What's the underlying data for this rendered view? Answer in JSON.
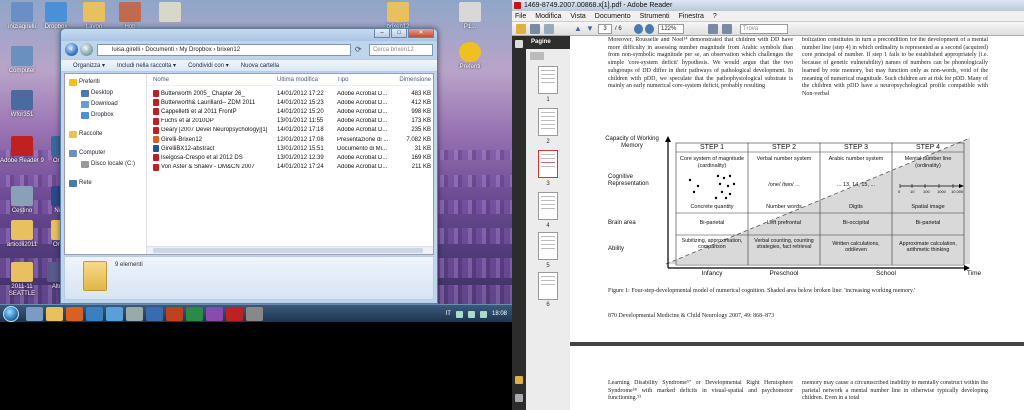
{
  "desktop": {
    "icons": [
      {
        "label": "iniziagirelli",
        "color": "#6b8fc4"
      },
      {
        "label": "Dropbox",
        "color": "#4a8fd8"
      },
      {
        "label": "Lavori",
        "color": "#e8c060"
      },
      {
        "label": "Hob",
        "color": "#c06a50"
      },
      {
        "label": "",
        "color": "#d8d8c8"
      },
      {
        "label": "brixen12",
        "color": "#e8c060"
      },
      {
        "label": "P1...",
        "color": "#d8d8d8"
      },
      {
        "label": "Computer",
        "color": "#6a90c0"
      },
      {
        "label": "Preferiti",
        "color": "#f0c020"
      },
      {
        "label": "Wfor351",
        "color": "#4a6aa0"
      },
      {
        "label": "Adobe Reader 9",
        "color": "#c02020"
      },
      {
        "label": "Ordine",
        "color": "#3a6a9a"
      },
      {
        "label": "Nokia",
        "color": "#2a4a8a"
      },
      {
        "label": "Cestino",
        "color": "#8aa0b8"
      },
      {
        "label": "articoli2011",
        "color": "#e8c060"
      },
      {
        "label": "Ordine",
        "color": "#e8c060"
      },
      {
        "label": "2011-11 SEATTLE",
        "color": "#e8c060"
      },
      {
        "label": "Altro",
        "color": "#5a5a8a"
      }
    ]
  },
  "taskbar": {
    "language": "IT",
    "clock": "18:08"
  },
  "explorer": {
    "address": "luisa.girelli  ›  Documenti  ›  My Dropbox  ›  brixen12",
    "search_placeholder": "Cerca brixen12",
    "toolbar": [
      "Organizza ▾",
      "Includi nella raccolta ▾",
      "Condividi con ▾",
      "Nuova cartella"
    ],
    "nav": {
      "favorites": "Preferiti",
      "desktop": "Desktop",
      "downloads": "Download",
      "dropbox": "Dropbox",
      "libraries": "Raccolte",
      "computer": "Computer",
      "local_disk": "Disco locale (C:)",
      "network": "Rete"
    },
    "columns": {
      "name": "Nome",
      "modified": "Ultima modifica",
      "type": "Tipo",
      "size": "Dimensione"
    },
    "files": [
      {
        "name": "Butterworth 2005_ Chapter 26_",
        "modified": "14/01/2012 17:22",
        "type": "Adobe Acrobat D...",
        "size": "483 KB",
        "color": "#c02020"
      },
      {
        "name": "Butterworth& Laurillard-- ZDM 2011",
        "modified": "14/01/2012 15:23",
        "type": "Adobe Acrobat D...",
        "size": "412 KB",
        "color": "#c02020"
      },
      {
        "name": "Cappelletti et al 2011 FrontP",
        "modified": "14/01/2012 15:20",
        "type": "Adobe Acrobat D...",
        "size": "998 KB",
        "color": "#c02020"
      },
      {
        "name": "Fuchs et al 2010DP",
        "modified": "13/01/2012 11:55",
        "type": "Adobe Acrobat D...",
        "size": "173 KB",
        "color": "#c02020"
      },
      {
        "name": "Geary [2007 Devel Neuropsychology][1]",
        "modified": "14/01/2012 17:18",
        "type": "Adobe Acrobat D...",
        "size": "235 KB",
        "color": "#c02020"
      },
      {
        "name": "Girelli-Brixen12",
        "modified": "12/01/2012 17:08",
        "type": "Presentazione di ...",
        "size": "7.082 KB",
        "color": "#d86020"
      },
      {
        "name": "GirelliBX12-abstract",
        "modified": "13/01/2012 15:51",
        "type": "Documento di Mi...",
        "size": "31 KB",
        "color": "#2050a0"
      },
      {
        "name": "Iseigosa-Crespo et al 2012 DS",
        "modified": "13/01/2012 12:39",
        "type": "Adobe Acrobat D...",
        "size": "169 KB",
        "color": "#c02020"
      },
      {
        "name": "Von Aster & Shalev - DM&CN 2007",
        "modified": "14/01/2012 17:24",
        "type": "Adobe Acrobat D...",
        "size": "211 KB",
        "color": "#c02020"
      }
    ],
    "status": "9 elementi"
  },
  "reader": {
    "title": "1469-8749.2007.00868.x[1].pdf - Adobe Reader",
    "menu": [
      "File",
      "Modifica",
      "Vista",
      "Documento",
      "Strumenti",
      "Finestra",
      "?"
    ],
    "page_current": "3",
    "page_total": "/ 6",
    "zoom": "122%",
    "find_placeholder": "Trova",
    "pages_panel_title": "Pagine",
    "thumbnails": [
      "1",
      "2",
      "3",
      "4",
      "5",
      "6"
    ],
    "col1_text": "Moreover, Rousselle and Noel¹⁴ demonstrated that children with DD have more difficulty in assessing number magnitude from Arabic symbols than from non-symbolic magnitude per se, an observation which challenges the simple 'core-system deficit' hypothesis. We would argue that the two subgroups of DD differ in their pathways of pathological development. In children with pDD, we speculate that the pathophysiological substrate is mainly an early numerical core-system deficit, probably resulting",
    "col2_text": "bolization constitutes in turn a precondition for the development of a mental number line (step 4) in which ordinality is represented as a second (acquired) core principal of number. If step 1 fails to be established appropriately (i.e. because of genetic vulnerability) names of numbers can be phonologically learned by rote memory, but may function only as non-words, void of the meaning of numerical magnitude. Such children are at risk for pDD. Many of the children with pDD have a neuropsychological profile compatible with Non-verbal",
    "figure": {
      "capacity_label": "Capacity of Working Memory",
      "steps": [
        "STEP 1",
        "STEP 2",
        "STEP 3",
        "STEP 4"
      ],
      "rows": [
        "Cognitive Representation",
        "Brain area",
        "Ability"
      ],
      "cognitive": [
        {
          "title": "Core system of magnitude (cardinality)",
          "foot": "Concrete quantity"
        },
        {
          "title": "Verbal number system",
          "mid": "/one/ /two/ ...",
          "foot": "Number words"
        },
        {
          "title": "Arabic number system",
          "mid": "... 13, 14, 15, ...",
          "foot": "Digits"
        },
        {
          "title": "Mental number line (ordinality)",
          "foot": "Spatial image"
        }
      ],
      "numberline_ticks": [
        "0",
        "10",
        "100",
        "1000",
        "10.000"
      ],
      "brain": [
        "Bi-parietal",
        "Left prefrontal",
        "Bi-occipital",
        "Bi-parietal"
      ],
      "ability": [
        "Subitizing, approximation, comparison",
        "Verbal counting, counting strategies, fact retrieval",
        "Written calculations, odd/even",
        "Approximate calculation, arithmetic thinking"
      ],
      "timeline": [
        "Infancy",
        "Preschool",
        "School"
      ],
      "time_label": "Time"
    },
    "caption": "Figure 1: Four-step-developmental model of numerical cognition. Shaded area below broken line: 'increasing working memory.'",
    "footer": "870   Developmental Medicine & Child Neurology 2007, 49: 868–873",
    "next_col1": "Learning Disability Syndrome⁵⁷ or Developmental Right Hemisphere Syndrome⁵⁸ with marked deficits in visual-spatial and psychomotor functioning.⁵³",
    "next_col2": "memory may cause a circumscribed inability to mentally construct within the parietal network a mental number line in otherwise typically developing children. Even in a total"
  }
}
